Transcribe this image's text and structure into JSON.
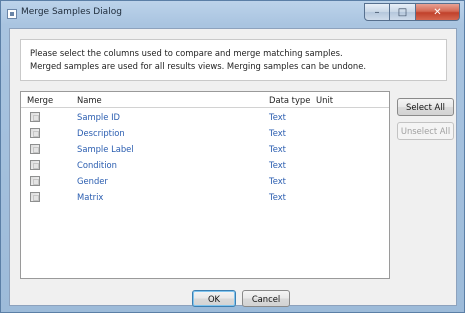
{
  "window": {
    "title": "Merge Samples Dialog",
    "caption_buttons": {
      "minimize": "–",
      "maximize": "□",
      "close": "✕"
    }
  },
  "intro": {
    "line1": "Please select the columns used to compare and merge matching samples.",
    "line2": "Merged samples are used for all results views. Merging samples can be undone."
  },
  "table": {
    "headers": {
      "merge": "Merge",
      "name": "Name",
      "data_type": "Data type",
      "unit": "Unit"
    },
    "rows": [
      {
        "merge": false,
        "name": "Sample ID",
        "data_type": "Text",
        "unit": ""
      },
      {
        "merge": false,
        "name": "Description",
        "data_type": "Text",
        "unit": ""
      },
      {
        "merge": false,
        "name": "Sample Label",
        "data_type": "Text",
        "unit": ""
      },
      {
        "merge": false,
        "name": "Condition",
        "data_type": "Text",
        "unit": ""
      },
      {
        "merge": false,
        "name": "Gender",
        "data_type": "Text",
        "unit": ""
      },
      {
        "merge": false,
        "name": "Matrix",
        "data_type": "Text",
        "unit": ""
      }
    ]
  },
  "side_buttons": {
    "select_all": "Select All",
    "unselect_all": "Unselect All",
    "unselect_all_enabled": false
  },
  "footer": {
    "ok": "OK",
    "cancel": "Cancel"
  },
  "colors": {
    "link_text": "#2a5db0",
    "title_bar": "#a9c4e0",
    "close_button": "#c1412b"
  }
}
